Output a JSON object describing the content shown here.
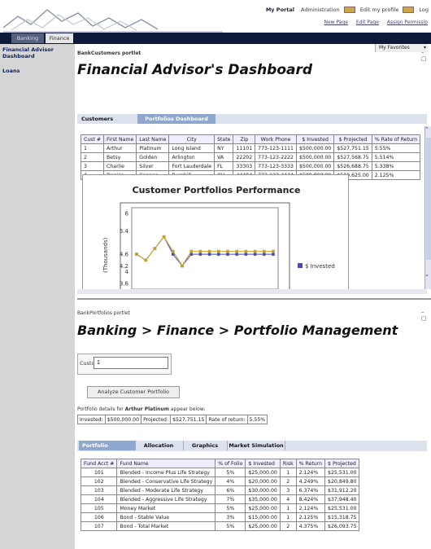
{
  "header": {
    "topnav": [
      "My Portal",
      "Administration",
      "Edit my profile",
      "Log"
    ],
    "subnav": [
      "New Page",
      "Edit Page",
      "Assign Permissio"
    ]
  },
  "nav": {
    "tabs": [
      "Banking",
      "Finance"
    ],
    "favorites": "My Favorites"
  },
  "sidebar": {
    "items": [
      "Financial Advisor Dashboard",
      "Loans"
    ]
  },
  "portlet1": {
    "name": "BankCustomers portlet",
    "title": "Financial Advisor's Dashboard",
    "tabs": [
      "Customers",
      "Portfolios Dashboard"
    ],
    "table": {
      "headers": [
        "Cust #",
        "First Name",
        "Last Name",
        "City",
        "State",
        "Zip",
        "Work Phone",
        "$ Invested",
        "$ Projected",
        "% Rate of Return"
      ],
      "rows": [
        [
          "1",
          "Arthur",
          "Platinum",
          "Long Island",
          "NY",
          "11101",
          "773-123-1111",
          "$500,000.00",
          "$527,751.15",
          "5.55%"
        ],
        [
          "2",
          "Betsy",
          "Golden",
          "Arlington",
          "VA",
          "22202",
          "773-123-2222",
          "$500,000.00",
          "$527,568.75",
          "5.514%"
        ],
        [
          "3",
          "Charlie",
          "Silver",
          "Fort Lauderdale",
          "FL",
          "33303",
          "773-123-3333",
          "$500,000.00",
          "$526,688.75",
          "5.338%"
        ],
        [
          "4",
          "Denise",
          "Copper",
          "Burghill",
          "OH",
          "44404",
          "773-123-4444",
          "$500,000.00",
          "$510,625.00",
          "2.125%"
        ]
      ]
    }
  },
  "chart_data": {
    "type": "line",
    "title": "Customer Portfolios Performance",
    "ylabel": "(Thousands)",
    "yticks": [
      "3.6",
      "4",
      "4.2",
      "4.6",
      "5.4",
      "6"
    ],
    "ylim": [
      3.4,
      6.2
    ],
    "series": [
      {
        "name": "$ Invested",
        "color": "#4a4ab8",
        "values": [
          4.6,
          4.4,
          4.8,
          5.2,
          4.6,
          4.2,
          4.6,
          4.6,
          4.6,
          4.6,
          4.6,
          4.6,
          4.6,
          4.6,
          4.6,
          4.6
        ]
      },
      {
        "name": "",
        "color": "#c9a21c",
        "values": [
          4.6,
          4.4,
          4.8,
          5.2,
          4.7,
          4.2,
          4.7,
          4.7,
          4.7,
          4.7,
          4.7,
          4.7,
          4.7,
          4.7,
          4.7,
          4.7
        ]
      }
    ],
    "legend": "$ Invested",
    "legend_position": "right"
  },
  "portlet2": {
    "name": "BankPortfolios portlet",
    "title": "Banking > Finance > Portfolio Management",
    "customer_label": "Customer #",
    "customer_value": "1",
    "analyze_label": "Analyze Customer Portfolio",
    "details_prefix": "Portfolio details for ",
    "details_name": "Arthur Platinum",
    "details_suffix": " appear below:",
    "summary": [
      "Invested:",
      "$500,000.00",
      "Projected:",
      "$527,751.15",
      "Rate of return:",
      "5.55%"
    ],
    "tabs": [
      "Portfolio",
      "Allocation",
      "Graphics",
      "Market Simulation"
    ],
    "table": {
      "headers": [
        "Fund Acct #",
        "Fund Name",
        "% of Folio",
        "$ Invested",
        "Risk",
        "% Return",
        "$ Projected"
      ],
      "rows": [
        [
          "101",
          "Blended - Income Plus Life Strategy",
          "5%",
          "$25,000.00",
          "1",
          "2.124%",
          "$25,531.00"
        ],
        [
          "102",
          "Blended - Conservative Life Strategy",
          "4%",
          "$20,000.00",
          "2",
          "4.249%",
          "$20,849.80"
        ],
        [
          "103",
          "Blended - Moderate Life Strategy",
          "6%",
          "$30,000.00",
          "3",
          "6.374%",
          "$31,912.20"
        ],
        [
          "104",
          "Blended - Aggressive Life Strategy",
          "7%",
          "$35,000.00",
          "4",
          "8.424%",
          "$37,948.40"
        ],
        [
          "105",
          "Money Market",
          "5%",
          "$25,000.00",
          "1",
          "2.124%",
          "$25,531.00"
        ],
        [
          "106",
          "Bond - Stable Value",
          "3%",
          "$15,000.00",
          "1",
          "2.125%",
          "$15,318.75"
        ],
        [
          "107",
          "Bond - Total Market",
          "5%",
          "$25,000.00",
          "2",
          "4.375%",
          "$26,093.75"
        ]
      ]
    }
  }
}
